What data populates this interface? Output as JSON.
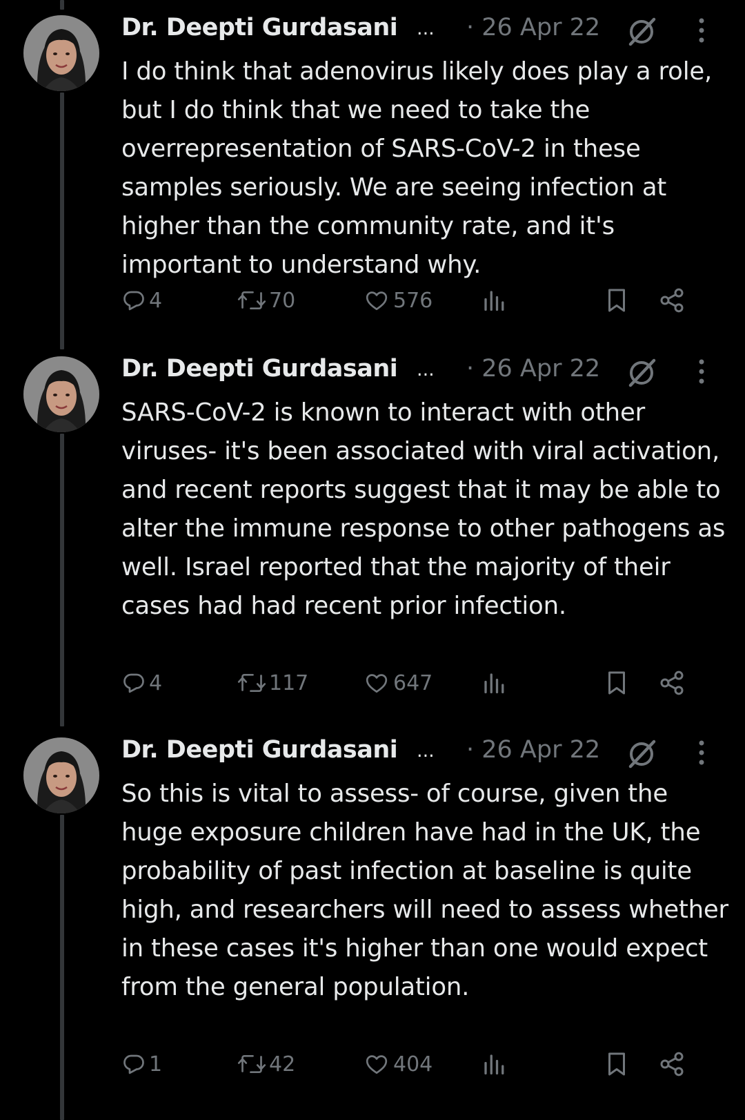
{
  "colors": {
    "background": "#000000",
    "primary_text": "#e7e9ea",
    "secondary_text": "#71767b",
    "thread_line": "#333639"
  },
  "tweets": [
    {
      "author": "Dr. Deepti Gurdasani",
      "truncation": "...",
      "date": "· 26 Apr 22",
      "text": "I do think that adenovirus likely does play a role, but I do think that we need to take the overrepresentation of SARS-CoV-2 in these samples seriously. We are seeing infection at higher than the community rate, and it's important to understand why.",
      "replies": "4",
      "reposts": "70",
      "likes": "576"
    },
    {
      "author": "Dr. Deepti Gurdasani",
      "truncation": "...",
      "date": "· 26 Apr 22",
      "text": "SARS-CoV-2 is known to interact with other viruses- it's been associated with viral activation, and recent reports suggest that it may be able to alter the immune response to other pathogens as well. Israel reported that the majority of their cases had had recent prior infection.",
      "replies": "4",
      "reposts": "117",
      "likes": "647"
    },
    {
      "author": "Dr. Deepti Gurdasani",
      "truncation": "...",
      "date": "· 26 Apr 22",
      "text": "So this is vital to assess- of course, given the huge exposure children have had in the UK, the probability of past infection at baseline is quite high, and researchers will need to assess whether in these cases it's higher than one would expect from the general population.",
      "replies": "1",
      "reposts": "42",
      "likes": "404"
    }
  ],
  "icons": {
    "reply": "reply-icon",
    "repost": "repost-icon",
    "like": "heart-icon",
    "views": "views-icon",
    "bookmark": "bookmark-icon",
    "share": "share-icon",
    "grok": "grok-icon",
    "more": "more-icon"
  }
}
